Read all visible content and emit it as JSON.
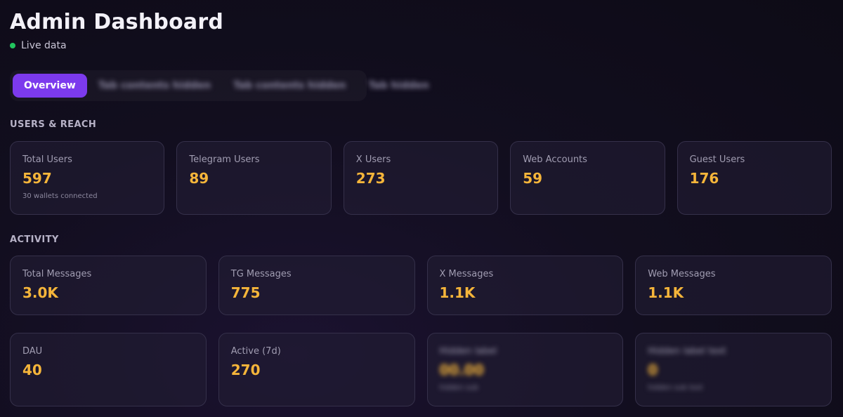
{
  "colors": {
    "accent": "#7c3aed",
    "value": "#f5b53a",
    "live_dot": "#22c55e"
  },
  "header": {
    "title": "Admin Dashboard",
    "live_label": "Live data"
  },
  "tabs": [
    {
      "label": "Overview",
      "active": true,
      "blurred": false
    },
    {
      "label": "Tab contents hidden",
      "active": false,
      "blurred": true
    },
    {
      "label": "Tab contents hidden",
      "active": false,
      "blurred": true
    },
    {
      "label": "Tab hidden",
      "active": false,
      "blurred": true
    }
  ],
  "users_reach": {
    "label": "USERS & REACH",
    "cards": [
      {
        "label": "Total Users",
        "value": "597",
        "sub": "30 wallets connected"
      },
      {
        "label": "Telegram Users",
        "value": "89"
      },
      {
        "label": "X Users",
        "value": "273"
      },
      {
        "label": "Web Accounts",
        "value": "59"
      },
      {
        "label": "Guest Users",
        "value": "176"
      }
    ]
  },
  "activity": {
    "label": "ACTIVITY",
    "cards": [
      {
        "label": "Total Messages",
        "value": "3.0K"
      },
      {
        "label": "TG Messages",
        "value": "775"
      },
      {
        "label": "X Messages",
        "value": "1.1K"
      },
      {
        "label": "Web Messages",
        "value": "1.1K"
      }
    ],
    "cards_row2": [
      {
        "label": "DAU",
        "value": "40"
      },
      {
        "label": "Active (7d)",
        "value": "270"
      },
      {
        "label": "Hidden label",
        "value": "00.00",
        "sub": "hidden sub",
        "blurred": true
      },
      {
        "label": "Hidden label text",
        "value": "0",
        "sub": "hidden sub text",
        "blurred": true
      }
    ]
  }
}
